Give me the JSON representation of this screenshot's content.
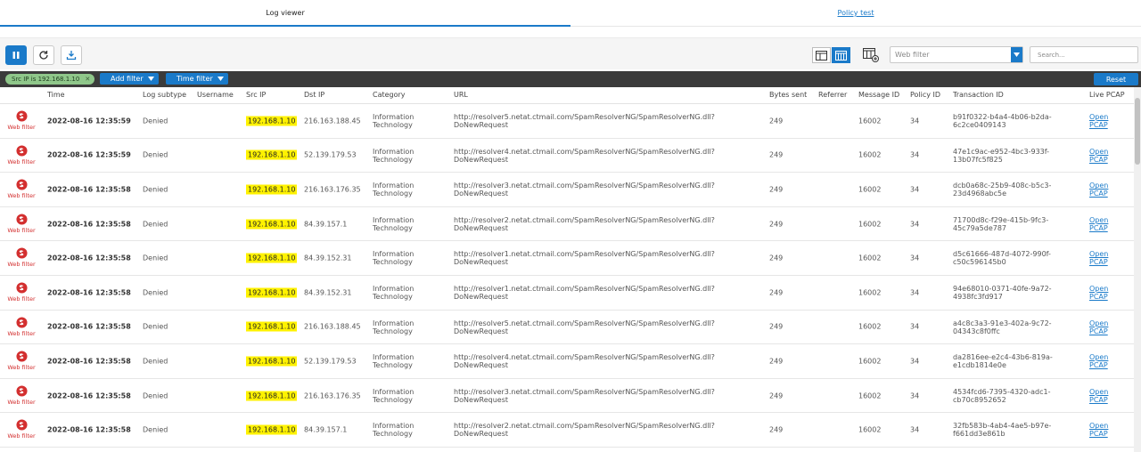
{
  "tabs": [
    {
      "label": "Log viewer",
      "active": true
    },
    {
      "label": "Policy test",
      "active": false
    }
  ],
  "toolbar": {
    "web_filter_value": "Web filter",
    "search_placeholder": "Search..."
  },
  "filters": {
    "chip_label": "Src IP is 192.168.1.10",
    "add_filter": "Add filter",
    "time_filter": "Time filter",
    "reset": "Reset"
  },
  "columns": {
    "time": "Time",
    "log_subtype": "Log subtype",
    "username": "Username",
    "src_ip": "Src IP",
    "dst_ip": "Dst IP",
    "category": "Category",
    "url": "URL",
    "bytes_sent": "Bytes sent",
    "referrer": "Referrer",
    "message_id": "Message ID",
    "policy_id": "Policy ID",
    "transaction_id": "Transaction ID",
    "live_pcap": "Live PCAP"
  },
  "module_label": "Web filter",
  "rows": [
    {
      "time": "2022-08-16 12:35:59",
      "subtype": "Denied",
      "src": "192.168.1.10",
      "dst": "216.163.188.45",
      "cat1": "Information",
      "cat2": "Technology",
      "url1": "http://resolver5.netat.ctmail.com/SpamResolverNG/SpamResolverNG.dll?",
      "url2": "DoNewRequest",
      "bytes": "249",
      "msg": "16002",
      "pol": "34",
      "tid1": "b91f0322-b4a4-4b06-b2da-",
      "tid2": "6c2ce0409143",
      "pcap1": "Open",
      "pcap2": "PCAP"
    },
    {
      "time": "2022-08-16 12:35:59",
      "subtype": "Denied",
      "src": "192.168.1.10",
      "dst": "52.139.179.53",
      "cat1": "Information",
      "cat2": "Technology",
      "url1": "http://resolver4.netat.ctmail.com/SpamResolverNG/SpamResolverNG.dll?",
      "url2": "DoNewRequest",
      "bytes": "249",
      "msg": "16002",
      "pol": "34",
      "tid1": "47e1c9ac-e952-4bc3-933f-",
      "tid2": "13b07fc5f825",
      "pcap1": "Open",
      "pcap2": "PCAP"
    },
    {
      "time": "2022-08-16 12:35:58",
      "subtype": "Denied",
      "src": "192.168.1.10",
      "dst": "216.163.176.35",
      "cat1": "Information",
      "cat2": "Technology",
      "url1": "http://resolver3.netat.ctmail.com/SpamResolverNG/SpamResolverNG.dll?",
      "url2": "DoNewRequest",
      "bytes": "249",
      "msg": "16002",
      "pol": "34",
      "tid1": "dcb0a68c-25b9-408c-b5c3-",
      "tid2": "23d4968abc5e",
      "pcap1": "Open",
      "pcap2": "PCAP"
    },
    {
      "time": "2022-08-16 12:35:58",
      "subtype": "Denied",
      "src": "192.168.1.10",
      "dst": "84.39.157.1",
      "cat1": "Information",
      "cat2": "Technology",
      "url1": "http://resolver2.netat.ctmail.com/SpamResolverNG/SpamResolverNG.dll?",
      "url2": "DoNewRequest",
      "bytes": "249",
      "msg": "16002",
      "pol": "34",
      "tid1": "71700d8c-f29e-415b-9fc3-",
      "tid2": "45c79a5de787",
      "pcap1": "Open",
      "pcap2": "PCAP"
    },
    {
      "time": "2022-08-16 12:35:58",
      "subtype": "Denied",
      "src": "192.168.1.10",
      "dst": "84.39.152.31",
      "cat1": "Information",
      "cat2": "Technology",
      "url1": "http://resolver1.netat.ctmail.com/SpamResolverNG/SpamResolverNG.dll?",
      "url2": "DoNewRequest",
      "bytes": "249",
      "msg": "16002",
      "pol": "34",
      "tid1": "d5c61666-487d-4072-990f-",
      "tid2": "c50c596145b0",
      "pcap1": "Open",
      "pcap2": "PCAP"
    },
    {
      "time": "2022-08-16 12:35:58",
      "subtype": "Denied",
      "src": "192.168.1.10",
      "dst": "84.39.152.31",
      "cat1": "Information",
      "cat2": "Technology",
      "url1": "http://resolver1.netat.ctmail.com/SpamResolverNG/SpamResolverNG.dll?",
      "url2": "DoNewRequest",
      "bytes": "249",
      "msg": "16002",
      "pol": "34",
      "tid1": "94e68010-0371-40fe-9a72-",
      "tid2": "4938fc3fd917",
      "pcap1": "Open",
      "pcap2": "PCAP"
    },
    {
      "time": "2022-08-16 12:35:58",
      "subtype": "Denied",
      "src": "192.168.1.10",
      "dst": "216.163.188.45",
      "cat1": "Information",
      "cat2": "Technology",
      "url1": "http://resolver5.netat.ctmail.com/SpamResolverNG/SpamResolverNG.dll?",
      "url2": "DoNewRequest",
      "bytes": "249",
      "msg": "16002",
      "pol": "34",
      "tid1": "a4c8c3a3-91e3-402a-9c72-",
      "tid2": "04343c8f0ffc",
      "pcap1": "Open",
      "pcap2": "PCAP"
    },
    {
      "time": "2022-08-16 12:35:58",
      "subtype": "Denied",
      "src": "192.168.1.10",
      "dst": "52.139.179.53",
      "cat1": "Information",
      "cat2": "Technology",
      "url1": "http://resolver4.netat.ctmail.com/SpamResolverNG/SpamResolverNG.dll?",
      "url2": "DoNewRequest",
      "bytes": "249",
      "msg": "16002",
      "pol": "34",
      "tid1": "da2816ee-e2c4-43b6-819a-",
      "tid2": "e1cdb1814e0e",
      "pcap1": "Open",
      "pcap2": "PCAP"
    },
    {
      "time": "2022-08-16 12:35:58",
      "subtype": "Denied",
      "src": "192.168.1.10",
      "dst": "216.163.176.35",
      "cat1": "Information",
      "cat2": "Technology",
      "url1": "http://resolver3.netat.ctmail.com/SpamResolverNG/SpamResolverNG.dll?",
      "url2": "DoNewRequest",
      "bytes": "249",
      "msg": "16002",
      "pol": "34",
      "tid1": "4534fcd6-7395-4320-adc1-",
      "tid2": "cb70c8952652",
      "pcap1": "Open",
      "pcap2": "PCAP"
    },
    {
      "time": "2022-08-16 12:35:58",
      "subtype": "Denied",
      "src": "192.168.1.10",
      "dst": "84.39.157.1",
      "cat1": "Information",
      "cat2": "Technology",
      "url1": "http://resolver2.netat.ctmail.com/SpamResolverNG/SpamResolverNG.dll?",
      "url2": "DoNewRequest",
      "bytes": "249",
      "msg": "16002",
      "pol": "34",
      "tid1": "32fb583b-4ab4-4ae5-b97e-",
      "tid2": "f661dd3e861b",
      "pcap1": "Open",
      "pcap2": "PCAP"
    }
  ],
  "colors": {
    "accent": "#1a7ac9",
    "highlight": "#fff200",
    "danger": "#d32f2f",
    "filterbar": "#3b3b3b",
    "chip": "#8fc78a"
  },
  "icons": [
    "pause-icon",
    "refresh-icon",
    "download-icon",
    "table-view-icon",
    "grid-view-icon",
    "column-settings-icon",
    "chevron-down-icon",
    "web-filter-icon",
    "close-icon"
  ]
}
